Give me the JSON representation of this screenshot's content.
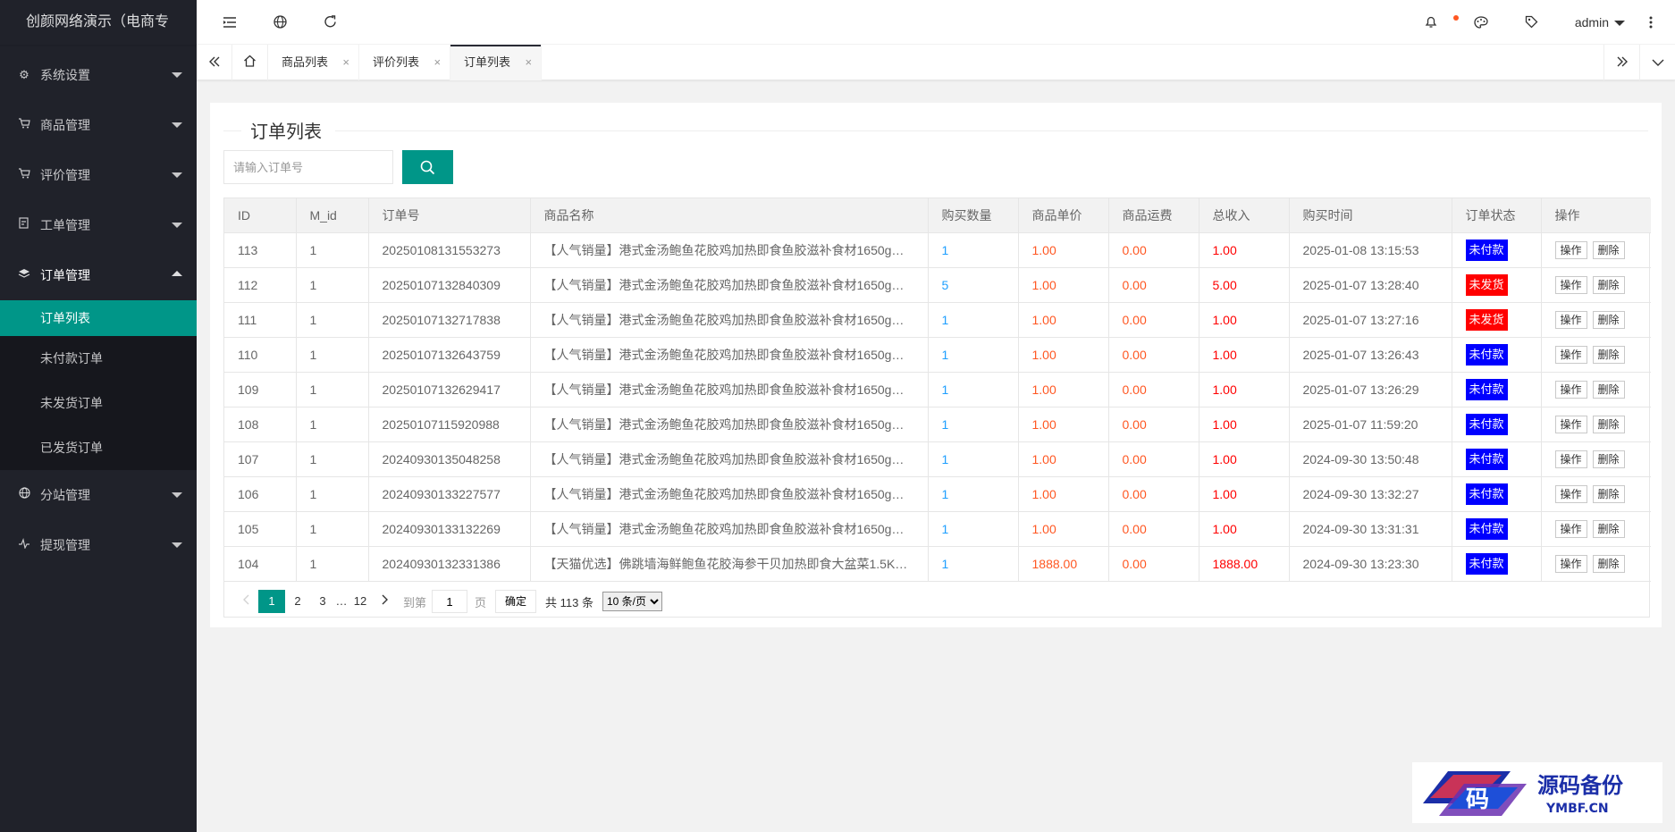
{
  "app": {
    "brand": "创颜网络演示（电商专"
  },
  "sidebar": {
    "items": [
      {
        "label": "系统设置",
        "icon": "gear-icon"
      },
      {
        "label": "商品管理",
        "icon": "cart-icon"
      },
      {
        "label": "评价管理",
        "icon": "cart-icon"
      },
      {
        "label": "工单管理",
        "icon": "ticket-icon"
      },
      {
        "label": "订单管理",
        "icon": "layers-icon"
      },
      {
        "label": "分站管理",
        "icon": "globe-icon"
      },
      {
        "label": "提现管理",
        "icon": "pulse-icon"
      }
    ],
    "order_sub": [
      "订单列表",
      "未付款订单",
      "未发货订单",
      "已发货订单"
    ]
  },
  "header": {
    "user": "admin"
  },
  "tabs": [
    {
      "label": "商品列表",
      "close": "×"
    },
    {
      "label": "评价列表",
      "close": "×"
    },
    {
      "label": "订单列表",
      "close": "×"
    }
  ],
  "page": {
    "title": "订单列表",
    "search_placeholder": "请输入订单号"
  },
  "table": {
    "columns": [
      "ID",
      "M_id",
      "订单号",
      "商品名称",
      "购买数量",
      "商品单价",
      "商品运费",
      "总收入",
      "购买时间",
      "订单状态",
      "操作"
    ],
    "action_edit": "操作",
    "action_delete": "删除",
    "rows": [
      {
        "id": "113",
        "mid": "1",
        "order_no": "20250108131553273",
        "name": "【人气销量】港式金汤鲍鱼花胶鸡加热即食鱼胶滋补食材1650g…",
        "qty": "1",
        "price": "1.00",
        "shipping": "0.00",
        "total": "1.00",
        "time": "2025-01-08 13:15:53",
        "status": "未付款",
        "status_color": "#0000ff"
      },
      {
        "id": "112",
        "mid": "1",
        "order_no": "20250107132840309",
        "name": "【人气销量】港式金汤鲍鱼花胶鸡加热即食鱼胶滋补食材1650g…",
        "qty": "5",
        "price": "1.00",
        "shipping": "0.00",
        "total": "5.00",
        "time": "2025-01-07 13:28:40",
        "status": "未发货",
        "status_color": "#ff0000"
      },
      {
        "id": "111",
        "mid": "1",
        "order_no": "20250107132717838",
        "name": "【人气销量】港式金汤鲍鱼花胶鸡加热即食鱼胶滋补食材1650g…",
        "qty": "1",
        "price": "1.00",
        "shipping": "0.00",
        "total": "1.00",
        "time": "2025-01-07 13:27:16",
        "status": "未发货",
        "status_color": "#ff0000"
      },
      {
        "id": "110",
        "mid": "1",
        "order_no": "20250107132643759",
        "name": "【人气销量】港式金汤鲍鱼花胶鸡加热即食鱼胶滋补食材1650g…",
        "qty": "1",
        "price": "1.00",
        "shipping": "0.00",
        "total": "1.00",
        "time": "2025-01-07 13:26:43",
        "status": "未付款",
        "status_color": "#0000ff"
      },
      {
        "id": "109",
        "mid": "1",
        "order_no": "20250107132629417",
        "name": "【人气销量】港式金汤鲍鱼花胶鸡加热即食鱼胶滋补食材1650g…",
        "qty": "1",
        "price": "1.00",
        "shipping": "0.00",
        "total": "1.00",
        "time": "2025-01-07 13:26:29",
        "status": "未付款",
        "status_color": "#0000ff"
      },
      {
        "id": "108",
        "mid": "1",
        "order_no": "20250107115920988",
        "name": "【人气销量】港式金汤鲍鱼花胶鸡加热即食鱼胶滋补食材1650g…",
        "qty": "1",
        "price": "1.00",
        "shipping": "0.00",
        "total": "1.00",
        "time": "2025-01-07 11:59:20",
        "status": "未付款",
        "status_color": "#0000ff"
      },
      {
        "id": "107",
        "mid": "1",
        "order_no": "20240930135048258",
        "name": "【人气销量】港式金汤鲍鱼花胶鸡加热即食鱼胶滋补食材1650g…",
        "qty": "1",
        "price": "1.00",
        "shipping": "0.00",
        "total": "1.00",
        "time": "2024-09-30 13:50:48",
        "status": "未付款",
        "status_color": "#0000ff"
      },
      {
        "id": "106",
        "mid": "1",
        "order_no": "20240930133227577",
        "name": "【人气销量】港式金汤鲍鱼花胶鸡加热即食鱼胶滋补食材1650g…",
        "qty": "1",
        "price": "1.00",
        "shipping": "0.00",
        "total": "1.00",
        "time": "2024-09-30 13:32:27",
        "status": "未付款",
        "status_color": "#0000ff"
      },
      {
        "id": "105",
        "mid": "1",
        "order_no": "20240930133132269",
        "name": "【人气销量】港式金汤鲍鱼花胶鸡加热即食鱼胶滋补食材1650g…",
        "qty": "1",
        "price": "1.00",
        "shipping": "0.00",
        "total": "1.00",
        "time": "2024-09-30 13:31:31",
        "status": "未付款",
        "status_color": "#0000ff"
      },
      {
        "id": "104",
        "mid": "1",
        "order_no": "20240930132331386",
        "name": "【天猫优选】佛跳墙海鲜鲍鱼花胶海参干贝加热即食大盆菜1.5K…",
        "qty": "1",
        "price": "1888.00",
        "shipping": "0.00",
        "total": "1888.00",
        "time": "2024-09-30 13:23:30",
        "status": "未付款",
        "status_color": "#0000ff"
      }
    ]
  },
  "pager": {
    "pages": [
      "1",
      "2",
      "3",
      "…",
      "12"
    ],
    "goto": "到第",
    "page_value": "1",
    "page_unit": "页",
    "confirm": "确定",
    "total": "共 113 条",
    "limit": "10 条/页"
  },
  "watermark": {
    "glyph": "码",
    "title": "源码备份",
    "site": "YMBF.CN"
  },
  "colors": {
    "accent": "#009688",
    "sidebar": "#20222a",
    "blue": "#1e9fff",
    "orange": "#ff5722"
  }
}
